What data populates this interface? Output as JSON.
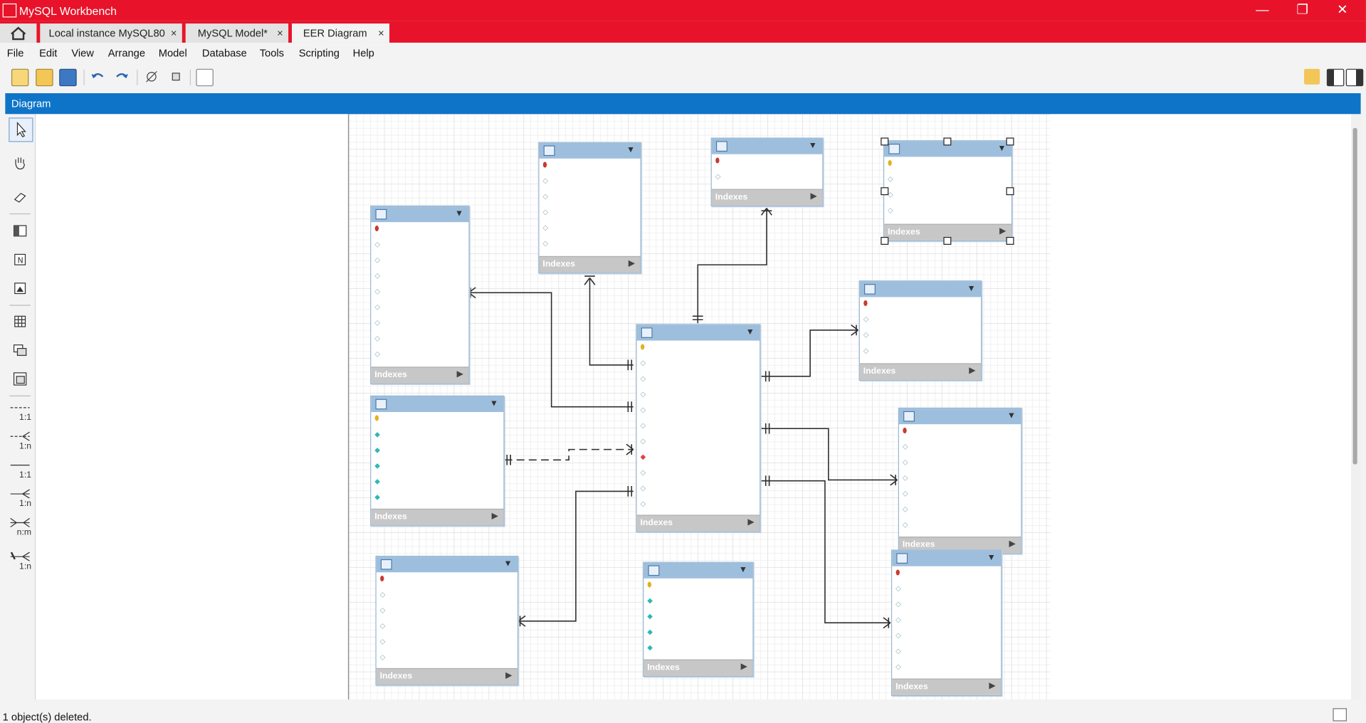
{
  "window": {
    "title": "MySQL Workbench",
    "minimize": "—",
    "restore": "❐",
    "close": "✕"
  },
  "tabs": [
    {
      "label": "",
      "icon": "home-icon"
    },
    {
      "label": "Local instance MySQL80",
      "close": "×"
    },
    {
      "label": "MySQL Model*",
      "close": "×"
    },
    {
      "label": "EER Diagram",
      "close": "×"
    }
  ],
  "menu": [
    "File",
    "Edit",
    "View",
    "Arrange",
    "Model",
    "Database",
    "Tools",
    "Scripting",
    "Help"
  ],
  "diagram_title": "Diagram",
  "palette": {
    "rel_11_id": "1:1",
    "rel_1n_id": "1:n",
    "rel_11": "1:1",
    "rel_1n": "1:n",
    "rel_nm": "n:m",
    "rel_1n_existing": "1:n"
  },
  "tables_footer": "Indexes",
  "status": "1 object(s) deleted.",
  "colors": {
    "accent": "#e8132a",
    "diagram_bar": "#0e74c8",
    "table_header": "#9dbfdd"
  }
}
